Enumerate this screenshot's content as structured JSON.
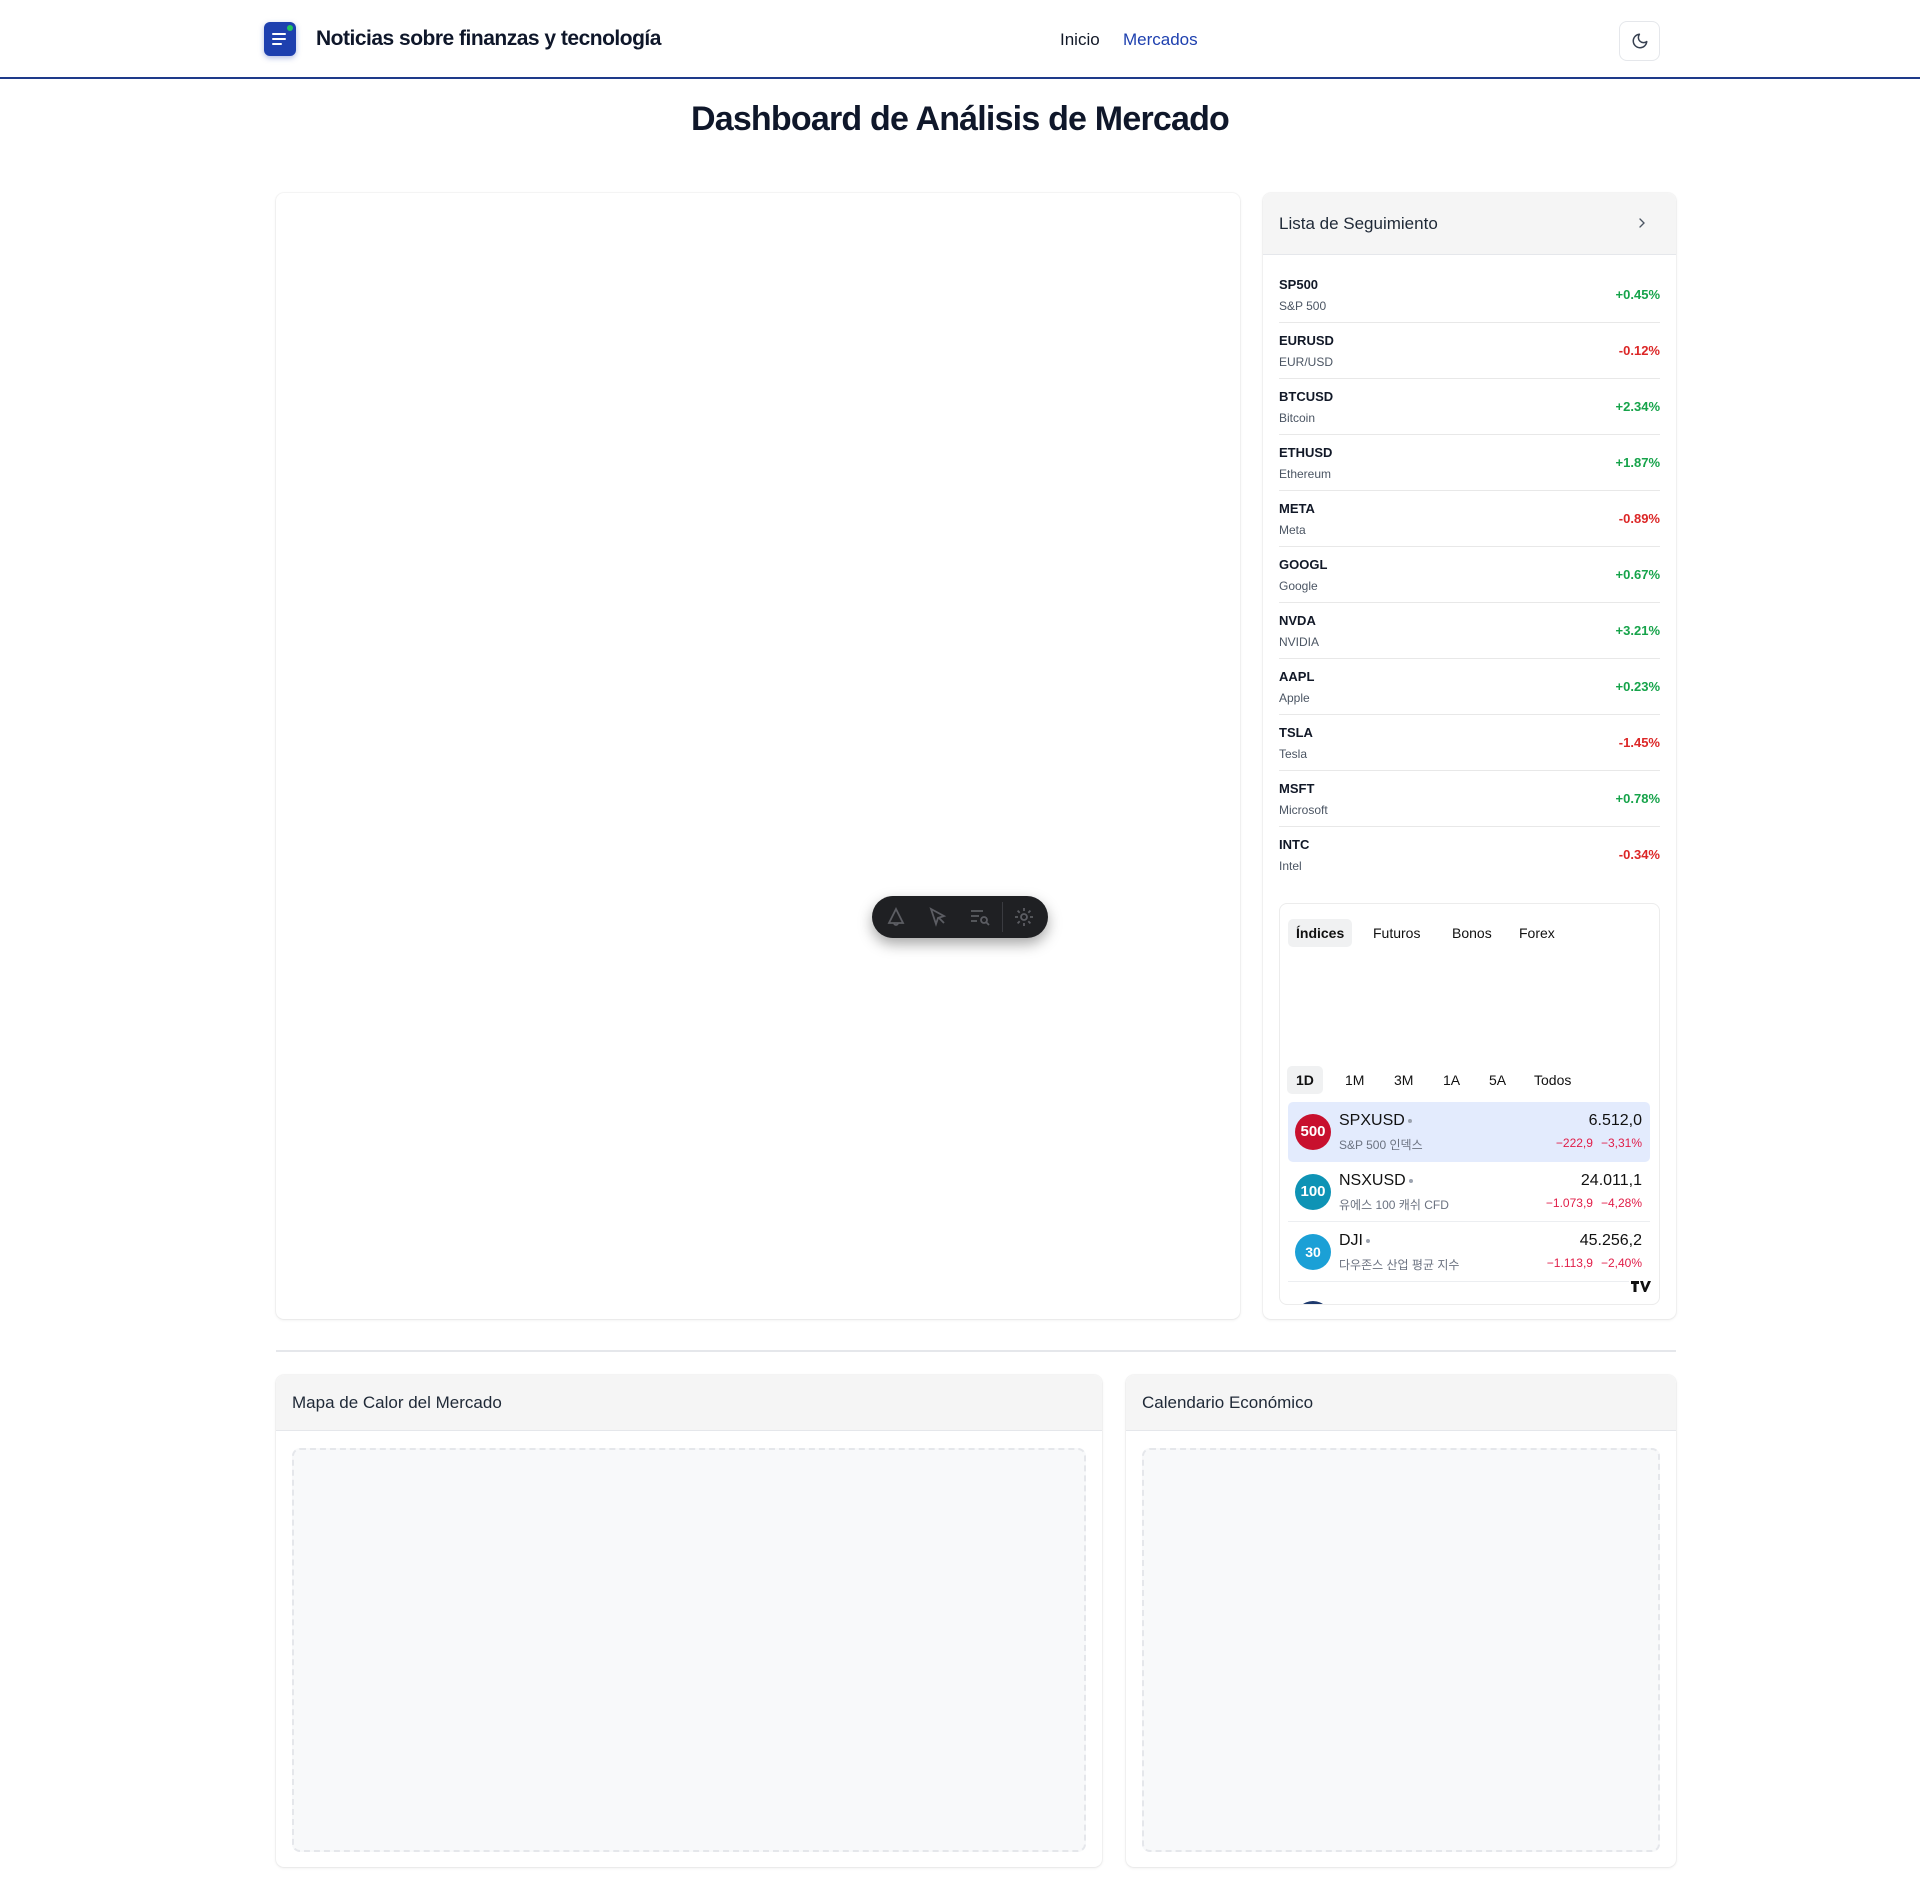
{
  "header": {
    "site_title": "Noticias sobre finanzas y tecnología",
    "nav": [
      {
        "label": "Inicio",
        "active": false
      },
      {
        "label": "Mercados",
        "active": true
      }
    ],
    "theme_toggle_icon": "moon-icon",
    "logo_icon": "news-icon"
  },
  "page_title": "Dashboard de Análisis de Mercado",
  "chart_toolbar": {
    "icons": [
      "alert-icon",
      "cursor-icon",
      "object-tree-icon",
      "settings-icon"
    ]
  },
  "watchlist": {
    "title": "Lista de Seguimiento",
    "items": [
      {
        "symbol": "SP500",
        "name": "S&P 500",
        "change": "+0.45%"
      },
      {
        "symbol": "EURUSD",
        "name": "EUR/USD",
        "change": "-0.12%"
      },
      {
        "symbol": "BTCUSD",
        "name": "Bitcoin",
        "change": "+2.34%"
      },
      {
        "symbol": "ETHUSD",
        "name": "Ethereum",
        "change": "+1.87%"
      },
      {
        "symbol": "META",
        "name": "Meta",
        "change": "-0.89%"
      },
      {
        "symbol": "GOOGL",
        "name": "Google",
        "change": "+0.67%"
      },
      {
        "symbol": "NVDA",
        "name": "NVIDIA",
        "change": "+3.21%"
      },
      {
        "symbol": "AAPL",
        "name": "Apple",
        "change": "+0.23%"
      },
      {
        "symbol": "TSLA",
        "name": "Tesla",
        "change": "-1.45%"
      },
      {
        "symbol": "MSFT",
        "name": "Microsoft",
        "change": "+0.78%"
      },
      {
        "symbol": "INTC",
        "name": "Intel",
        "change": "-0.34%"
      }
    ]
  },
  "market_tabs": {
    "tabs": [
      "Índices",
      "Futuros",
      "Bonos",
      "Forex"
    ],
    "active_tab": "Índices",
    "ranges": [
      "1D",
      "1M",
      "3M",
      "1A",
      "5A",
      "Todos"
    ],
    "active_range": "1D",
    "quotes": [
      {
        "badge": "500",
        "badge_color": "#c8102e",
        "symbol": "SPXUSD",
        "desc": "S&P 500 인덱스",
        "price": "6.512,0",
        "change": "−222,9",
        "change_pct": "−3,31%",
        "selected": true
      },
      {
        "badge": "100",
        "badge_color": "#0e93b5",
        "symbol": "NSXUSD",
        "desc": "유에스 100 캐쉬 CFD",
        "price": "24.011,1",
        "change": "−1.073,9",
        "change_pct": "−4,28%",
        "selected": false
      },
      {
        "badge": "30",
        "badge_color": "#1ba0d6",
        "symbol": "DJI",
        "desc": "다우존스 산업 평균 지수",
        "price": "45.256,2",
        "change": "−1.113,9",
        "change_pct": "−2,40%",
        "selected": false
      }
    ]
  },
  "colors": {
    "positive": "#16a34a",
    "negative": "#dc2626",
    "brand": "#1e40af"
  },
  "heatmap": {
    "title": "Mapa de Calor del Mercado"
  },
  "calendar": {
    "title": "Calendario Económico"
  }
}
